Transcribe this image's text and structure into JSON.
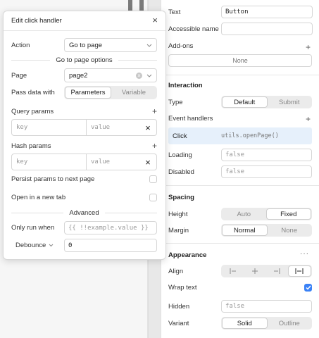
{
  "modal": {
    "title": "Edit click handler",
    "close_icon": "close-icon",
    "action_label": "Action",
    "action_value": "Go to page",
    "options_heading": "Go to page options",
    "page_label": "Page",
    "page_value": "page2",
    "pass_data_label": "Pass data with",
    "pass_data_options": [
      "Parameters",
      "Variable"
    ],
    "pass_data_selected": "Parameters",
    "query_params_label": "Query params",
    "query_key_placeholder": "key",
    "query_value_placeholder": "value",
    "hash_params_label": "Hash params",
    "hash_key_placeholder": "key",
    "hash_value_placeholder": "value",
    "persist_label": "Persist params to next page",
    "new_tab_label": "Open in a new tab",
    "advanced_heading": "Advanced",
    "only_run_label": "Only run when",
    "only_run_placeholder": "{{ !!example.value }}",
    "debounce_label": "Debounce",
    "debounce_value": "0"
  },
  "inspector": {
    "text_label": "Text",
    "text_value": "Button",
    "accessible_label": "Accessible name",
    "addons_label": "Add-ons",
    "addons_value": "None",
    "interaction_title": "Interaction",
    "type_label": "Type",
    "type_options": [
      "Default",
      "Submit"
    ],
    "event_handlers_label": "Event handlers",
    "handler_event": "Click",
    "handler_action": "utils.openPage()",
    "loading_label": "Loading",
    "loading_value": "false",
    "disabled_label": "Disabled",
    "disabled_value": "false",
    "spacing_title": "Spacing",
    "height_label": "Height",
    "height_options": [
      "Auto",
      "Fixed"
    ],
    "margin_label": "Margin",
    "margin_options": [
      "Normal",
      "None"
    ],
    "appearance_title": "Appearance",
    "more_icon": "more-icon",
    "align_label": "Align",
    "wrap_label": "Wrap text",
    "hidden_label": "Hidden",
    "hidden_value": "false",
    "variant_label": "Variant",
    "variant_options": [
      "Solid",
      "Outline"
    ]
  },
  "colors": {
    "accent": "#3b82f6",
    "handler_bg": "#e6f0fb"
  }
}
